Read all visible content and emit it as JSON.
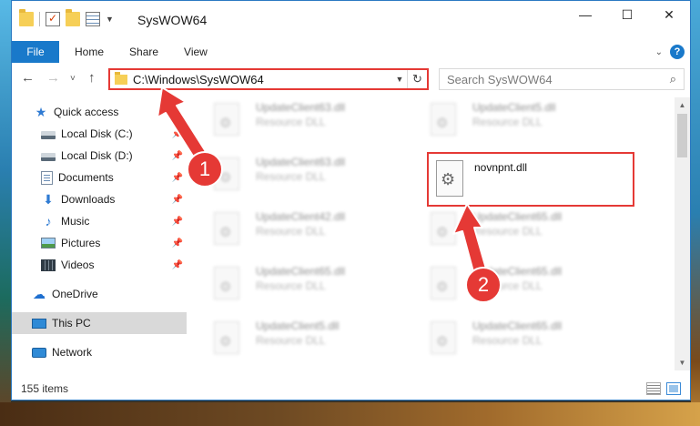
{
  "window": {
    "title": "SysWOW64",
    "controls": {
      "minimize": "—",
      "maximize": "☐",
      "close": "✕"
    }
  },
  "ribbon": {
    "tabs": [
      "File",
      "Home",
      "Share",
      "View"
    ],
    "help": "?"
  },
  "navbar": {
    "back": "←",
    "forward": "→",
    "recent": "˅",
    "up": "↑",
    "address": "C:\\Windows\\SysWOW64",
    "refresh": "↻",
    "search_placeholder": "Search SysWOW64",
    "search_icon": "⌕"
  },
  "sidebar": {
    "items": [
      {
        "label": "Quick access",
        "icon": "star-icon"
      },
      {
        "label": "Local Disk (C:)",
        "icon": "drive-icon",
        "pinned": true
      },
      {
        "label": "Local Disk (D:)",
        "icon": "drive-icon",
        "pinned": true
      },
      {
        "label": "Documents",
        "icon": "documents-icon",
        "pinned": true
      },
      {
        "label": "Downloads",
        "icon": "download-icon",
        "pinned": true
      },
      {
        "label": "Music",
        "icon": "music-icon",
        "pinned": true
      },
      {
        "label": "Pictures",
        "icon": "pictures-icon",
        "pinned": true
      },
      {
        "label": "Videos",
        "icon": "videos-icon",
        "pinned": true
      },
      {
        "label": "OneDrive",
        "icon": "cloud-icon"
      },
      {
        "label": "This PC",
        "icon": "computer-icon",
        "selected": true
      },
      {
        "label": "Network",
        "icon": "network-icon"
      }
    ],
    "pin_glyph": "📌"
  },
  "files": {
    "left_column": [
      {
        "name": "UpdateClient63.dll",
        "type": "Resource DLL"
      },
      {
        "name": "UpdateClient63.dll",
        "type": "Resource DLL"
      },
      {
        "name": "UpdateClient42.dll",
        "type": "Resource DLL"
      },
      {
        "name": "UpdateClient65.dll",
        "type": "Resource DLL"
      },
      {
        "name": "UpdateClient5.dll",
        "type": "Resource DLL"
      }
    ],
    "right_column": [
      {
        "name": "UpdateClient5.dll",
        "type": "Resource DLL"
      },
      {
        "name": "UpdateClient65.dll",
        "type": "Resource DLL"
      },
      {
        "name": "UpdateClient65.dll",
        "type": "Resource DLL"
      },
      {
        "name": "UpdateClient65.dll",
        "type": "Resource DLL"
      }
    ],
    "highlighted": {
      "name": "novnpnt.dll"
    }
  },
  "status": {
    "item_count": "155 items"
  },
  "annotations": {
    "step1": "1",
    "step2": "2",
    "color": "#e53935"
  }
}
